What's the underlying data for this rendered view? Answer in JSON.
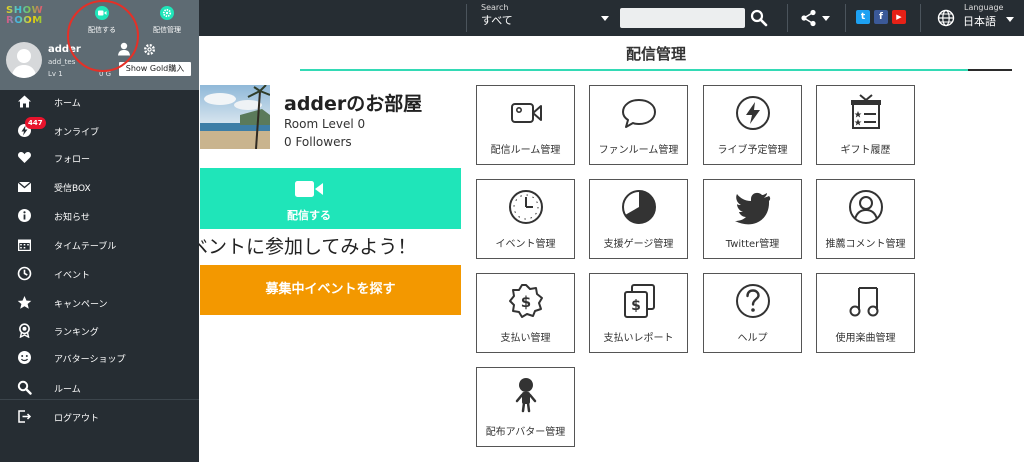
{
  "header": {
    "search_caption": "Search",
    "search_category": "すべて",
    "search_value": "",
    "language_caption": "Language",
    "language_value": "日本語",
    "social": [
      "t",
      "f",
      "▶"
    ]
  },
  "page": {
    "title": "配信管理"
  },
  "room": {
    "name": "adderのお部屋",
    "level": "Room Level 0",
    "followers": "0 Followers",
    "broadcast_label": "配信する",
    "event_promo": "ベントに参加してみよう！",
    "find_event_label": "募集中イベントを探す"
  },
  "tiles": [
    {
      "label": "配信ルーム管理",
      "icon": "video-camera-icon"
    },
    {
      "label": "ファンルーム管理",
      "icon": "speech-bubble-icon"
    },
    {
      "label": "ライブ予定管理",
      "icon": "lightning-icon"
    },
    {
      "label": "ギフト履歴",
      "icon": "gift-list-icon"
    },
    {
      "label": "イベント管理",
      "icon": "clock-icon"
    },
    {
      "label": "支援ゲージ管理",
      "icon": "gauge-icon"
    },
    {
      "label": "Twitter管理",
      "icon": "twitter-bird-icon"
    },
    {
      "label": "推薦コメント管理",
      "icon": "user-circle-icon"
    },
    {
      "label": "支払い管理",
      "icon": "dollar-badge-icon"
    },
    {
      "label": "支払いレポート",
      "icon": "dollar-documents-icon"
    },
    {
      "label": "ヘルプ",
      "icon": "question-circle-icon"
    },
    {
      "label": "使用楽曲管理",
      "icon": "music-note-icon"
    },
    {
      "label": "配布アバター管理",
      "icon": "avatar-figure-icon"
    }
  ],
  "sidebar": {
    "logo_line1": "SHOW",
    "logo_line2": "ROOM",
    "quick_broadcast": "配信する",
    "quick_manage": "配信管理",
    "user_name": "adder",
    "user_id": "add_tes",
    "user_level": "Lv 1",
    "user_gold": "0 G",
    "gold_button": "Show Gold購入",
    "onlive_badge": "447",
    "items": [
      {
        "label": "ホーム",
        "icon": "home-icon"
      },
      {
        "label": "オンライブ",
        "icon": "onlive-icon"
      },
      {
        "label": "フォロー",
        "icon": "heart-icon"
      },
      {
        "label": "受信BOX",
        "icon": "envelope-icon"
      },
      {
        "label": "お知らせ",
        "icon": "info-icon"
      },
      {
        "label": "タイムテーブル",
        "icon": "calendar-icon"
      },
      {
        "label": "イベント",
        "icon": "clock-icon"
      },
      {
        "label": "キャンペーン",
        "icon": "star-icon"
      },
      {
        "label": "ランキング",
        "icon": "award-icon"
      },
      {
        "label": "アバターショップ",
        "icon": "smiley-icon"
      },
      {
        "label": "ルーム",
        "icon": "search-icon"
      },
      {
        "label": "ログアウト",
        "icon": "logout-icon"
      }
    ]
  },
  "colors": {
    "accent": "#1fe5b9",
    "orange": "#f39800",
    "header_bg": "#262d33",
    "sidebar_top": "#5e6b73",
    "badge": "#e8132c",
    "highlight": "#e53027"
  }
}
